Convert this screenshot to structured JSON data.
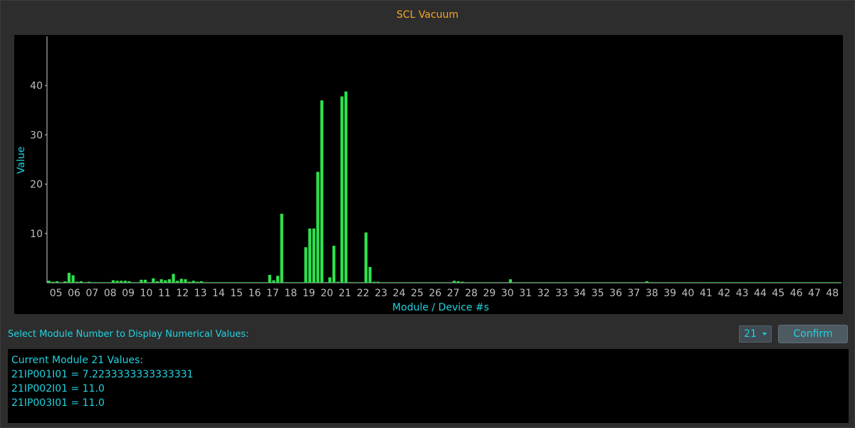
{
  "window": {
    "title": "SCL Vacuum"
  },
  "controls": {
    "select_label": "Select Module Number to Display Numerical Values:",
    "selected_module": "21",
    "confirm_label": "Confirm"
  },
  "values_panel": {
    "header": "Current Module 21 Values:",
    "lines": [
      "21IP001I01 = 7.2233333333333331",
      "21IP002I01 = 11.0",
      "21IP003I01 = 11.0"
    ]
  },
  "colors": {
    "bar": "#2ee04d",
    "axis_label": "#22d3e0",
    "tick_label": "#bfbfbf",
    "title": "#f5a623"
  },
  "chart_data": {
    "type": "bar",
    "xlabel": "Module / Device #s",
    "ylabel": "Value",
    "ylim": [
      0,
      50
    ],
    "yticks": [
      10,
      20,
      30,
      40
    ],
    "grid": false,
    "x_tick_labels": [
      "05",
      "06",
      "07",
      "08",
      "09",
      "10",
      "11",
      "12",
      "13",
      "14",
      "15",
      "16",
      "17",
      "18",
      "19",
      "20",
      "21",
      "22",
      "23",
      "24",
      "25",
      "26",
      "27",
      "28",
      "29",
      "30",
      "31",
      "32",
      "33",
      "34",
      "35",
      "36",
      "37",
      "38",
      "39",
      "40",
      "41",
      "42",
      "43",
      "44",
      "45",
      "46",
      "47",
      "48"
    ],
    "values": [
      0.4,
      0.2,
      0.3,
      0.1,
      0.3,
      2.0,
      1.5,
      0.2,
      0.3,
      0.1,
      0.2,
      0.1,
      0.1,
      0.1,
      0.1,
      0.1,
      0.5,
      0.4,
      0.4,
      0.4,
      0.3,
      0.1,
      0.1,
      0.6,
      0.6,
      0.1,
      0.9,
      0.3,
      0.7,
      0.5,
      0.7,
      1.8,
      0.4,
      0.8,
      0.7,
      0.2,
      0.4,
      0.2,
      0.3,
      0.1,
      0.1,
      0.1,
      0.1,
      0.1,
      0.1,
      0.1,
      0.1,
      0.1,
      0.1,
      0.1,
      0.1,
      0.1,
      0.1,
      0.1,
      0.1,
      1.6,
      0.5,
      1.4,
      14.0,
      0.1,
      0.1,
      0.1,
      0.1,
      0.1,
      7.2,
      11.0,
      11.0,
      22.5,
      37.0,
      0.1,
      1.1,
      7.5,
      0.2,
      37.8,
      38.8,
      0.1,
      0.1,
      0.1,
      0.1,
      10.2,
      3.2,
      0.2,
      0.2,
      0.1,
      0.1,
      0.1,
      0.1,
      0.1,
      0.1,
      0.1,
      0.1,
      0.1,
      0.1,
      0.1,
      0.1,
      0.1,
      0.1,
      0.1,
      0.1,
      0.1,
      0.1,
      0.4,
      0.3,
      0.2,
      0.1,
      0.1,
      0.1,
      0.1,
      0.1,
      0.1,
      0.1,
      0.1,
      0.1,
      0.1,
      0.1,
      0.7,
      0.1,
      0.1,
      0.1,
      0.1,
      0.1,
      0.1,
      0.1,
      0.1,
      0.1,
      0.1,
      0.1,
      0.1,
      0.1,
      0.1,
      0.1,
      0.1,
      0.1,
      0.1,
      0.1,
      0.1,
      0.1,
      0.1,
      0.1,
      0.1,
      0.1,
      0.1,
      0.1,
      0.1,
      0.1,
      0.1,
      0.1,
      0.1,
      0.1,
      0.3,
      0.1,
      0.1,
      0.1,
      0.1,
      0.1,
      0.1,
      0.1,
      0.1,
      0.1,
      0.1,
      0.1,
      0.1,
      0.1,
      0.1,
      0.1,
      0.1,
      0.1,
      0.1,
      0.1,
      0.1,
      0.1,
      0.1,
      0.1,
      0.1,
      0.1,
      0.1,
      0.1,
      0.1,
      0.1,
      0.1,
      0.1,
      0.1,
      0.1,
      0.1,
      0.1,
      0.1,
      0.1,
      0.1,
      0.1,
      0.1,
      0.1,
      0.1,
      0.1,
      0.1,
      0.1,
      0.1,
      0.1,
      0.1
    ]
  }
}
